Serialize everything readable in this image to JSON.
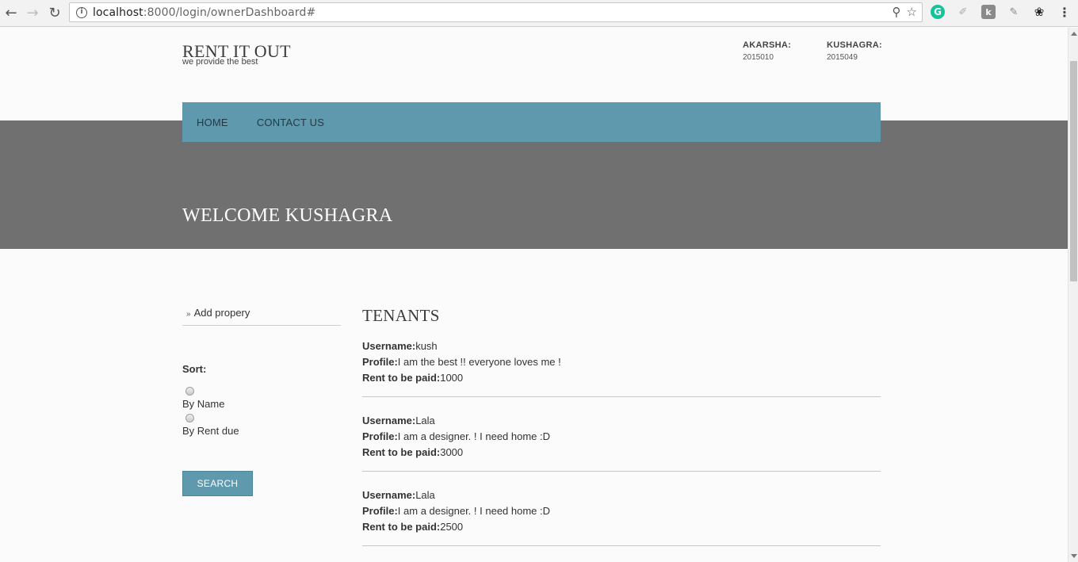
{
  "browser": {
    "url_host": "localhost",
    "url_rest": ":8000/login/ownerDashboard#",
    "icons": [
      "back-arrow-icon",
      "forward-arrow-icon",
      "reload-icon",
      "info-icon",
      "zoom-icon",
      "star-icon",
      "grammarly-icon",
      "extension-icon",
      "extension-k-icon",
      "pen-icon",
      "gnome-icon",
      "menu-icon"
    ]
  },
  "header": {
    "title": "RENT IT OUT",
    "subtitle": "we provide the best",
    "contacts": [
      {
        "name": "AKARSHA:",
        "id": "2015010"
      },
      {
        "name": "KUSHAGRA:",
        "id": "2015049"
      }
    ]
  },
  "nav": {
    "home": "HOME",
    "contact": "CONTACT US"
  },
  "hero": {
    "welcome": "WELCOME KUSHAGRA"
  },
  "sidebar": {
    "add_property": "Add propery",
    "sort_label": "Sort:",
    "sort_options": [
      "By Name",
      "By Rent due"
    ],
    "search_button": "SEARCH"
  },
  "tenants": {
    "title": "TENANTS",
    "labels": {
      "username": "Username:",
      "profile": "Profile:",
      "rent": "Rent to be paid:"
    },
    "list": [
      {
        "username": "kush",
        "profile": "I am the best !! everyone loves me !",
        "rent": "1000"
      },
      {
        "username": "Lala",
        "profile": "I am a designer. ! I need home :D",
        "rent": "3000"
      },
      {
        "username": "Lala",
        "profile": "I am a designer. ! I need home :D",
        "rent": "2500"
      }
    ]
  }
}
